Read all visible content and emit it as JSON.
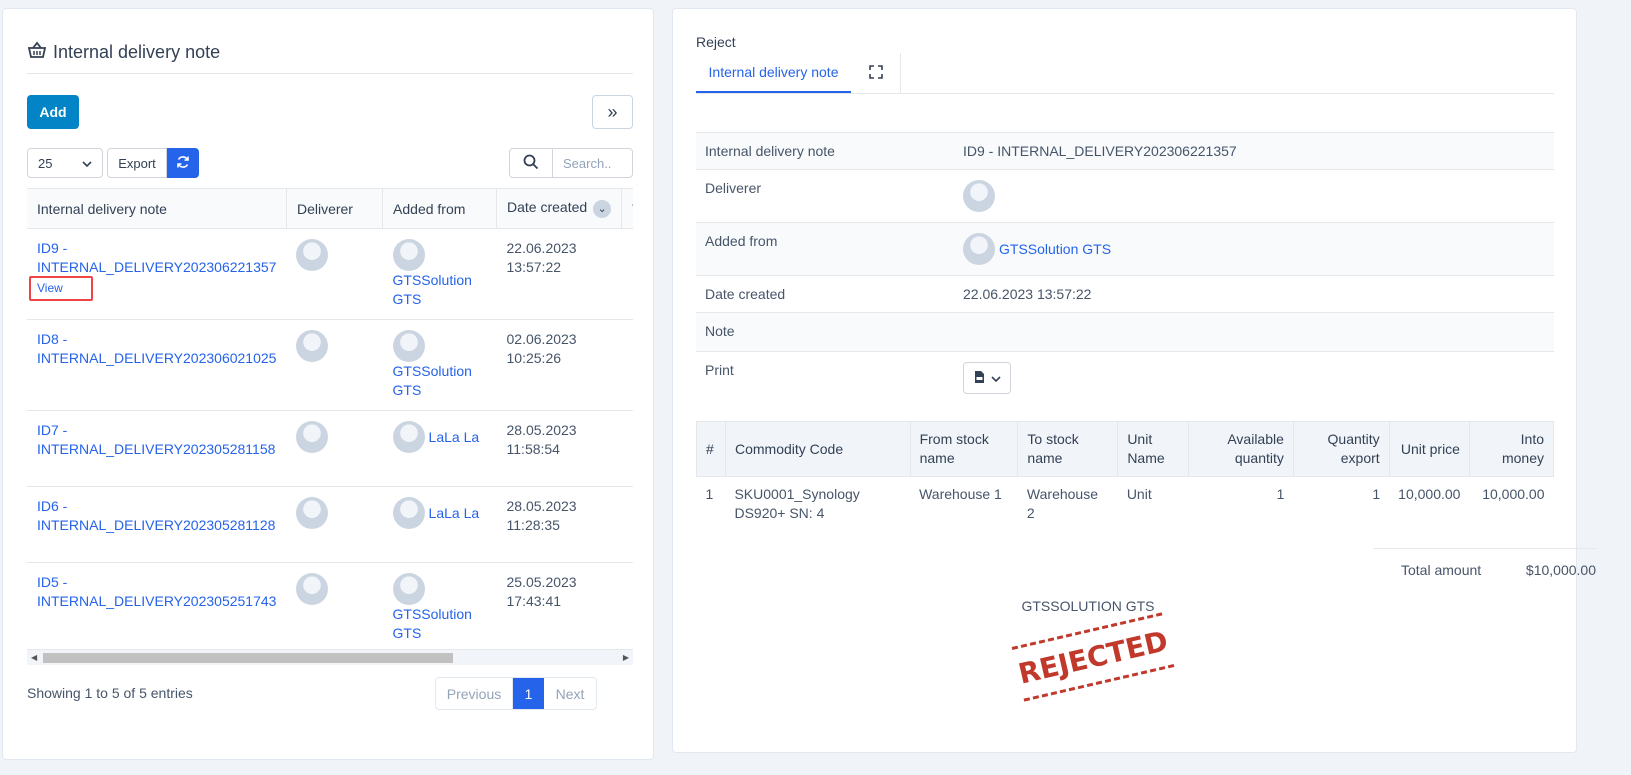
{
  "left": {
    "title": "Internal delivery note",
    "add_label": "Add",
    "page_size": "25",
    "export_label": "Export",
    "search_placeholder": "Search..",
    "columns": [
      "Internal delivery note",
      "Deliverer",
      "Added from",
      "Date created"
    ],
    "rows": [
      {
        "note": "ID9 - INTERNAL_DELIVERY202306221357",
        "view": "View",
        "added_from": "GTSSolution GTS",
        "date": "22.06.2023 13:57:22"
      },
      {
        "note": "ID8 - INTERNAL_DELIVERY202306021025",
        "added_from": "GTSSolution GTS",
        "date": "02.06.2023 10:25:26"
      },
      {
        "note": "ID7 - INTERNAL_DELIVERY202305281158",
        "added_from": "LaLa La",
        "date": "28.05.2023 11:58:54"
      },
      {
        "note": "ID6 - INTERNAL_DELIVERY202305281128",
        "added_from": "LaLa La",
        "date": "28.05.2023 11:28:35"
      },
      {
        "note": "ID5 - INTERNAL_DELIVERY202305251743",
        "added_from": "GTSSolution GTS",
        "date": "25.05.2023 17:43:41"
      }
    ],
    "showing": "Showing 1 to 5 of 5 entries",
    "pager": {
      "previous": "Previous",
      "current": "1",
      "next": "Next"
    }
  },
  "right": {
    "status": "Reject",
    "tab": "Internal delivery note",
    "info": {
      "note_label": "Internal delivery note",
      "note_value": "ID9 - INTERNAL_DELIVERY202306221357",
      "deliverer_label": "Deliverer",
      "added_label": "Added from",
      "added_value": "GTSSolution GTS",
      "date_label": "Date created",
      "date_value": "22.06.2023 13:57:22",
      "note2_label": "Note",
      "print_label": "Print"
    },
    "items_columns": [
      "#",
      "Commodity Code",
      "From stock name",
      "To stock name",
      "Unit Name",
      "Available quantity",
      "Quantity export",
      "Unit price",
      "Into money"
    ],
    "items": [
      {
        "no": "1",
        "code": "SKU0001_Synology DS920+ SN: 4",
        "from": "Warehouse 1",
        "to": "Warehouse 2",
        "unit": "Unit",
        "available": "1",
        "qty": "1",
        "price": "10,000.00",
        "money": "10,000.00"
      }
    ],
    "total_label": "Total amount",
    "total_value": "$10,000.00",
    "company": "GTSSOLUTION GTS",
    "stamp": "REJECTED"
  },
  "colors": {
    "primary": "#2563eb",
    "add": "#0284c7",
    "stamp": "#c0392b",
    "highlight": "#ef4444"
  }
}
